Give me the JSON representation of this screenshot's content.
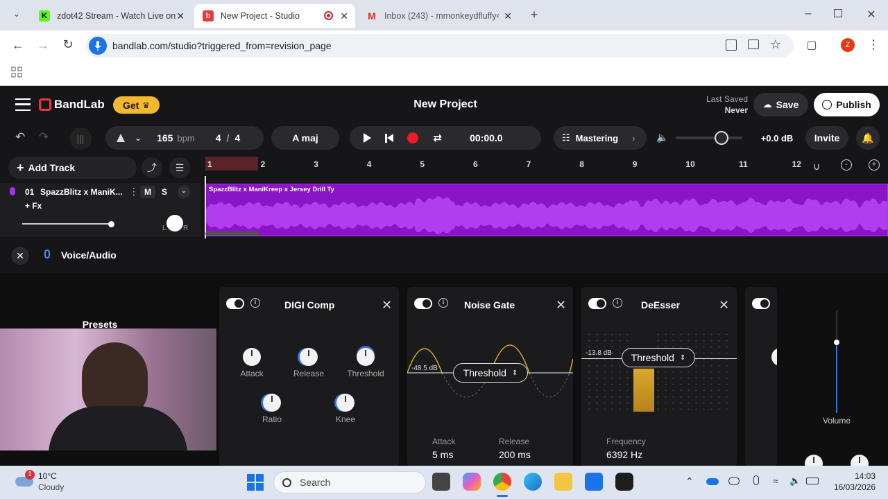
{
  "browser": {
    "tabs": [
      {
        "title": "zdot42 Stream - Watch Live on",
        "active": false
      },
      {
        "title": "New Project - Studio",
        "active": true
      },
      {
        "title": "Inbox (243) - mmonkeydfluffy4",
        "active": false
      }
    ],
    "url": "bandlab.com/studio?triggered_from=revision_page",
    "profile_initial": "Z",
    "colors": {
      "profile": "#e8380d"
    }
  },
  "app": {
    "brand": "BandLab",
    "get_label": "Get",
    "project_title": "New Project",
    "last_saved_label": "Last Saved",
    "last_saved_value": "Never",
    "save_label": "Save",
    "publish_label": "Publish",
    "colors": {
      "accent": "#f0343c",
      "get": "#f5b82e",
      "region": "#8a14c8"
    }
  },
  "transport": {
    "tempo": "165",
    "tempo_unit": "bpm",
    "time_sig_num": "4",
    "time_sig_sep": "/",
    "time_sig_den": "4",
    "key": "A maj",
    "time": "00:00.0",
    "mastering_label": "Mastering",
    "volume_db": "+0.0 dB",
    "invite_label": "Invite"
  },
  "tracks": {
    "add_track_label": "Add Track",
    "track": {
      "number": "01",
      "name": "SpazzBlitz x ManiK...",
      "mute": "M",
      "solo": "S",
      "fx_label": "+ Fx",
      "pan_left": "L",
      "pan_right": "R"
    },
    "region_title": "SpazzBlitz x ManiKreep x Jersey Drill Ty",
    "ruler": [
      "1",
      "2",
      "3",
      "4",
      "5",
      "6",
      "7",
      "8",
      "9",
      "10",
      "11",
      "12"
    ]
  },
  "fx_panel": {
    "track_type": "Voice/Audio",
    "presets_label": "Presets",
    "digi_comp": {
      "title": "DIGI Comp",
      "knobs": [
        "Attack",
        "Release",
        "Threshold",
        "Ratio",
        "Knee"
      ]
    },
    "noise_gate": {
      "title": "Noise Gate",
      "db": "-48.5 dB",
      "threshold_label": "Threshold",
      "attack_label": "Attack",
      "attack_value": "5 ms",
      "release_label": "Release",
      "release_value": "200 ms"
    },
    "deesser": {
      "title": "DeEsser",
      "db": "-13.8 dB",
      "threshold_label": "Threshold",
      "frequency_label": "Frequency",
      "frequency_value": "6392 Hz"
    },
    "volume_label": "Volume"
  },
  "taskbar": {
    "weather_temp": "10°C",
    "weather_desc": "Cloudy",
    "weather_badge": "1",
    "search_placeholder": "Search",
    "time": "14:03",
    "date": "16/03/2026"
  }
}
